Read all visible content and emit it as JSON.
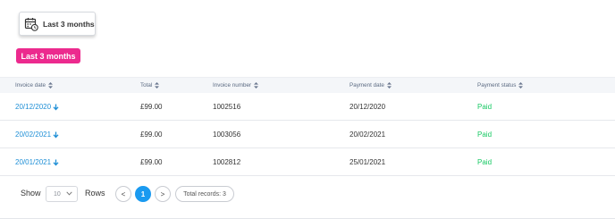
{
  "filter": {
    "date_range_button_label": "Last 3 months",
    "active_period_badge": "Last 3 months"
  },
  "table": {
    "columns": [
      "Invoice date",
      "Total",
      "Invoice number",
      "Payment date",
      "Payment status"
    ],
    "rows": [
      {
        "invoice_date": "20/12/2020",
        "total": "£99.00",
        "invoice_number": "1002516",
        "payment_date": "20/12/2020",
        "payment_status": "Paid"
      },
      {
        "invoice_date": "20/02/2021",
        "total": "£99.00",
        "invoice_number": "1003056",
        "payment_date": "20/02/2021",
        "payment_status": "Paid"
      },
      {
        "invoice_date": "20/01/2021",
        "total": "£99.00",
        "invoice_number": "1002812",
        "payment_date": "25/01/2021",
        "payment_status": "Paid"
      }
    ]
  },
  "pagination": {
    "show_label": "Show",
    "rows_per_page": "10",
    "rows_label": "Rows",
    "prev_label": "<",
    "current_page": "1",
    "next_label": ">",
    "total_records": "Total records: 3"
  },
  "colors": {
    "badge": "#ec2a8e",
    "link": "#1f8fd6",
    "paid": "#17c964",
    "active_page": "#1a9af0"
  }
}
